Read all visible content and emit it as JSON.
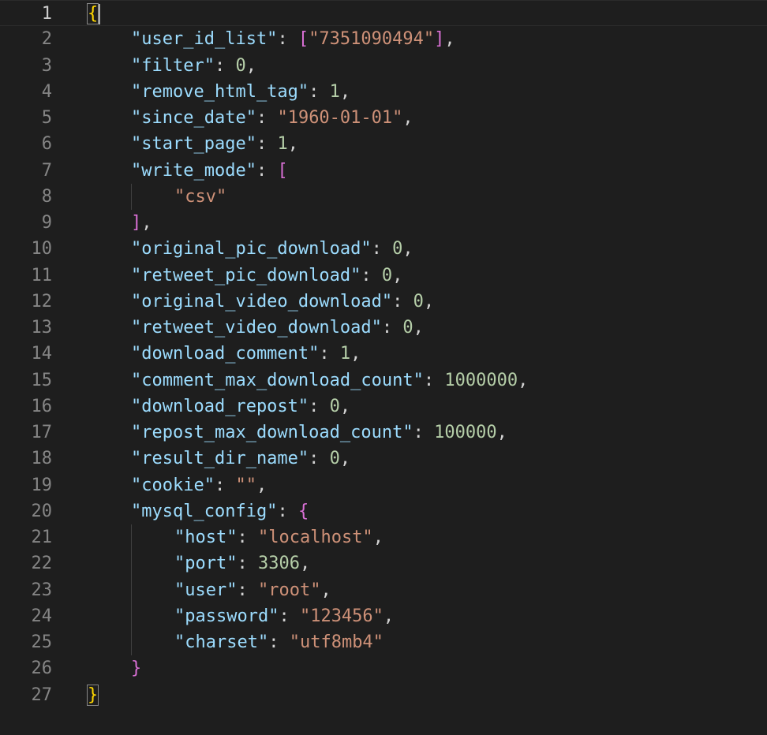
{
  "editor": {
    "current_line": 1,
    "lines": [
      {
        "n": "1",
        "indent": 0,
        "tokens": [
          {
            "t": "{",
            "c": "b1 bm"
          }
        ]
      },
      {
        "n": "2",
        "indent": 1,
        "tokens": [
          {
            "t": "\"user_id_list\"",
            "c": "key"
          },
          {
            "t": ": ",
            "c": "punc"
          },
          {
            "t": "[",
            "c": "b2"
          },
          {
            "t": "\"7351090494\"",
            "c": "str"
          },
          {
            "t": "]",
            "c": "b2"
          },
          {
            "t": ",",
            "c": "punc"
          }
        ]
      },
      {
        "n": "3",
        "indent": 1,
        "tokens": [
          {
            "t": "\"filter\"",
            "c": "key"
          },
          {
            "t": ": ",
            "c": "punc"
          },
          {
            "t": "0",
            "c": "num"
          },
          {
            "t": ",",
            "c": "punc"
          }
        ]
      },
      {
        "n": "4",
        "indent": 1,
        "tokens": [
          {
            "t": "\"remove_html_tag\"",
            "c": "key"
          },
          {
            "t": ": ",
            "c": "punc"
          },
          {
            "t": "1",
            "c": "num"
          },
          {
            "t": ",",
            "c": "punc"
          }
        ]
      },
      {
        "n": "5",
        "indent": 1,
        "tokens": [
          {
            "t": "\"since_date\"",
            "c": "key"
          },
          {
            "t": ": ",
            "c": "punc"
          },
          {
            "t": "\"1960-01-01\"",
            "c": "str"
          },
          {
            "t": ",",
            "c": "punc"
          }
        ]
      },
      {
        "n": "6",
        "indent": 1,
        "tokens": [
          {
            "t": "\"start_page\"",
            "c": "key"
          },
          {
            "t": ": ",
            "c": "punc"
          },
          {
            "t": "1",
            "c": "num"
          },
          {
            "t": ",",
            "c": "punc"
          }
        ]
      },
      {
        "n": "7",
        "indent": 1,
        "tokens": [
          {
            "t": "\"write_mode\"",
            "c": "key"
          },
          {
            "t": ": ",
            "c": "punc"
          },
          {
            "t": "[",
            "c": "b2"
          }
        ]
      },
      {
        "n": "8",
        "indent": 2,
        "tokens": [
          {
            "t": "\"csv\"",
            "c": "str"
          }
        ]
      },
      {
        "n": "9",
        "indent": 1,
        "tokens": [
          {
            "t": "]",
            "c": "b2"
          },
          {
            "t": ",",
            "c": "punc"
          }
        ]
      },
      {
        "n": "10",
        "indent": 1,
        "tokens": [
          {
            "t": "\"original_pic_download\"",
            "c": "key"
          },
          {
            "t": ": ",
            "c": "punc"
          },
          {
            "t": "0",
            "c": "num"
          },
          {
            "t": ",",
            "c": "punc"
          }
        ]
      },
      {
        "n": "11",
        "indent": 1,
        "tokens": [
          {
            "t": "\"retweet_pic_download\"",
            "c": "key"
          },
          {
            "t": ": ",
            "c": "punc"
          },
          {
            "t": "0",
            "c": "num"
          },
          {
            "t": ",",
            "c": "punc"
          }
        ]
      },
      {
        "n": "12",
        "indent": 1,
        "tokens": [
          {
            "t": "\"original_video_download\"",
            "c": "key"
          },
          {
            "t": ": ",
            "c": "punc"
          },
          {
            "t": "0",
            "c": "num"
          },
          {
            "t": ",",
            "c": "punc"
          }
        ]
      },
      {
        "n": "13",
        "indent": 1,
        "tokens": [
          {
            "t": "\"retweet_video_download\"",
            "c": "key"
          },
          {
            "t": ": ",
            "c": "punc"
          },
          {
            "t": "0",
            "c": "num"
          },
          {
            "t": ",",
            "c": "punc"
          }
        ]
      },
      {
        "n": "14",
        "indent": 1,
        "tokens": [
          {
            "t": "\"download_comment\"",
            "c": "key"
          },
          {
            "t": ": ",
            "c": "punc"
          },
          {
            "t": "1",
            "c": "num"
          },
          {
            "t": ",",
            "c": "punc"
          }
        ]
      },
      {
        "n": "15",
        "indent": 1,
        "tokens": [
          {
            "t": "\"comment_max_download_count\"",
            "c": "key"
          },
          {
            "t": ": ",
            "c": "punc"
          },
          {
            "t": "1000000",
            "c": "num"
          },
          {
            "t": ",",
            "c": "punc"
          }
        ]
      },
      {
        "n": "16",
        "indent": 1,
        "tokens": [
          {
            "t": "\"download_repost\"",
            "c": "key"
          },
          {
            "t": ": ",
            "c": "punc"
          },
          {
            "t": "0",
            "c": "num"
          },
          {
            "t": ",",
            "c": "punc"
          }
        ]
      },
      {
        "n": "17",
        "indent": 1,
        "tokens": [
          {
            "t": "\"repost_max_download_count\"",
            "c": "key"
          },
          {
            "t": ": ",
            "c": "punc"
          },
          {
            "t": "100000",
            "c": "num"
          },
          {
            "t": ",",
            "c": "punc"
          }
        ]
      },
      {
        "n": "18",
        "indent": 1,
        "tokens": [
          {
            "t": "\"result_dir_name\"",
            "c": "key"
          },
          {
            "t": ": ",
            "c": "punc"
          },
          {
            "t": "0",
            "c": "num"
          },
          {
            "t": ",",
            "c": "punc"
          }
        ]
      },
      {
        "n": "19",
        "indent": 1,
        "tokens": [
          {
            "t": "\"cookie\"",
            "c": "key"
          },
          {
            "t": ": ",
            "c": "punc"
          },
          {
            "t": "\"\"",
            "c": "str"
          },
          {
            "t": ",",
            "c": "punc"
          }
        ]
      },
      {
        "n": "20",
        "indent": 1,
        "tokens": [
          {
            "t": "\"mysql_config\"",
            "c": "key"
          },
          {
            "t": ": ",
            "c": "punc"
          },
          {
            "t": "{",
            "c": "b2"
          }
        ]
      },
      {
        "n": "21",
        "indent": 2,
        "tokens": [
          {
            "t": "\"host\"",
            "c": "key"
          },
          {
            "t": ": ",
            "c": "punc"
          },
          {
            "t": "\"localhost\"",
            "c": "str"
          },
          {
            "t": ",",
            "c": "punc"
          }
        ]
      },
      {
        "n": "22",
        "indent": 2,
        "tokens": [
          {
            "t": "\"port\"",
            "c": "key"
          },
          {
            "t": ": ",
            "c": "punc"
          },
          {
            "t": "3306",
            "c": "num"
          },
          {
            "t": ",",
            "c": "punc"
          }
        ]
      },
      {
        "n": "23",
        "indent": 2,
        "tokens": [
          {
            "t": "\"user\"",
            "c": "key"
          },
          {
            "t": ": ",
            "c": "punc"
          },
          {
            "t": "\"root\"",
            "c": "str"
          },
          {
            "t": ",",
            "c": "punc"
          }
        ]
      },
      {
        "n": "24",
        "indent": 2,
        "tokens": [
          {
            "t": "\"password\"",
            "c": "key"
          },
          {
            "t": ": ",
            "c": "punc"
          },
          {
            "t": "\"123456\"",
            "c": "str"
          },
          {
            "t": ",",
            "c": "punc"
          }
        ]
      },
      {
        "n": "25",
        "indent": 2,
        "tokens": [
          {
            "t": "\"charset\"",
            "c": "key"
          },
          {
            "t": ": ",
            "c": "punc"
          },
          {
            "t": "\"utf8mb4\"",
            "c": "str"
          }
        ]
      },
      {
        "n": "26",
        "indent": 1,
        "tokens": [
          {
            "t": "}",
            "c": "b2"
          }
        ]
      },
      {
        "n": "27",
        "indent": 0,
        "tokens": [
          {
            "t": "}",
            "c": "b1 bm"
          }
        ]
      }
    ]
  }
}
